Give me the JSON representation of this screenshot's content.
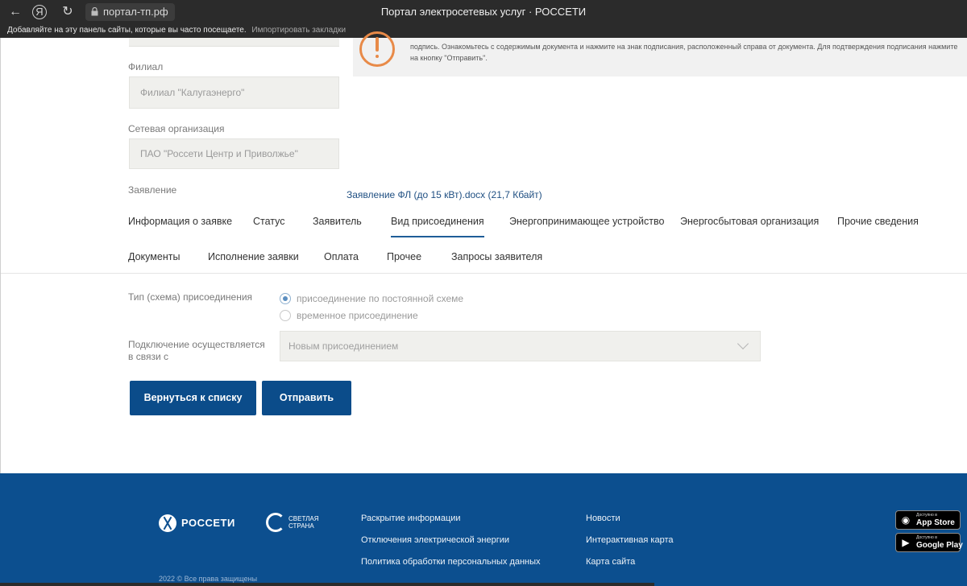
{
  "browser": {
    "url": "портал-тп.рф",
    "title": "Портал электросетевых услуг · РОССЕТИ",
    "bookmarks_prompt": "Добавляйте на эту панель сайты, которые вы часто посещаете.",
    "bookmarks_import": "Импортировать закладки"
  },
  "notice": {
    "text": "подпись. Ознакомьтесь с содержимым документа и нажмите на знак подписания, расположенный справа от документа. Для подтверждения подписания нажмите на кнопку \"Отправить\"."
  },
  "form": {
    "branch_label": "Филиал",
    "branch_value": "Филиал \"Калугаэнерго\"",
    "grid_org_label": "Сетевая организация",
    "grid_org_value": "ПАО \"Россети Центр и Приволжье\"",
    "application_label": "Заявление",
    "application_link": "Заявление ФЛ (до 15 кВт).docx (21,7 Кбайт)"
  },
  "tabs": {
    "row1": [
      "Информация о заявке",
      "Статус",
      "Заявитель",
      "Вид присоединения",
      "Энергопринимающее устройство",
      "Энергосбытовая организация",
      "Прочие сведения"
    ],
    "row2": [
      "Документы",
      "Исполнение заявки",
      "Оплата",
      "Прочее",
      "Запросы заявителя"
    ],
    "active": "Вид присоединения"
  },
  "connection": {
    "type_label": "Тип (схема) присоединения",
    "option_permanent": "присоединение по постоянной схеме",
    "option_temporary": "временное присоединение",
    "selected": "присоединение по постоянной схеме",
    "reason_label": "Подключение осуществляется в связи с",
    "reason_value": "Новым присоединением"
  },
  "buttons": {
    "back": "Вернуться к списку",
    "submit": "Отправить"
  },
  "footer": {
    "brand": "РОССЕТИ",
    "brand2_line1": "СВЕТЛАЯ",
    "brand2_line2": "СТРАНА",
    "links_col1": [
      "Раскрытие информации",
      "Отключения электрической энергии",
      "Политика обработки персональных данных"
    ],
    "links_col2": [
      "Новости",
      "Интерактивная карта",
      "Карта сайта"
    ],
    "copyright": "2022 © Все права защищены",
    "appstore_small": "Доступно в",
    "appstore_big": "App Store",
    "googleplay_small": "Доступно в",
    "googleplay_big": "Google Play"
  },
  "colors": {
    "primary": "#0b4c8a",
    "footer_bg": "#0c4f8f",
    "warning_icon": "#e88a48",
    "link": "#1f4f82"
  }
}
